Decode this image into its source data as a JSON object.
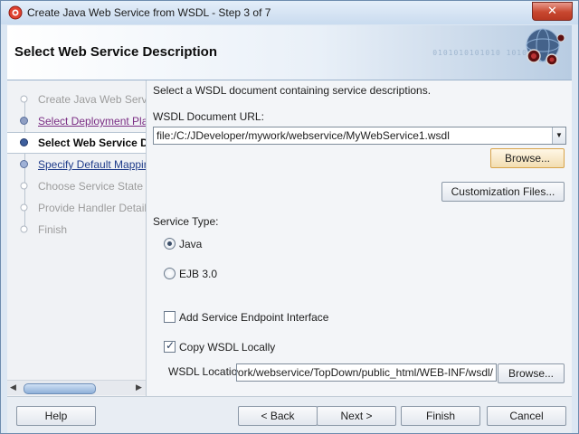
{
  "window": {
    "title": "Create Java Web Service from WSDL - Step 3 of 7",
    "close_symbol": "✕"
  },
  "header": {
    "title": "Select Web Service Description",
    "art_text": "0101010101010 101010101"
  },
  "nav": {
    "items": [
      {
        "label": "Create Java Web Servic",
        "state": "disabled"
      },
      {
        "label": "Select Deployment Platf",
        "state": "visited"
      },
      {
        "label": "Select Web Service D",
        "state": "current"
      },
      {
        "label": "Specify Default Mapping",
        "state": "link"
      },
      {
        "label": "Choose Service State",
        "state": "disabled"
      },
      {
        "label": "Provide Handler Details",
        "state": "disabled"
      },
      {
        "label": "Finish",
        "state": "disabled"
      }
    ],
    "scroll_left": "◀",
    "scroll_right": "▶"
  },
  "main": {
    "instruction": "Select a WSDL document containing service descriptions.",
    "wsdl_url_label": "WSDL Document URL:",
    "wsdl_url_value": "file:/C:/JDeveloper/mywork/webservice/MyWebService1.wsdl",
    "browse_label": "Browse...",
    "customization_label": "Customization Files...",
    "service_type_label": "Service Type:",
    "radio_java_label": "Java",
    "radio_ejb_label": "EJB 3.0",
    "radio_selected": "Java",
    "add_sei_label": "Add Service Endpoint Interface",
    "add_sei_checked": false,
    "copy_wsdl_label": "Copy WSDL Locally",
    "copy_wsdl_checked": true,
    "wsdl_location_label": "WSDL Location:",
    "wsdl_location_value": "/mywork/webservice/TopDown/public_html/WEB-INF/wsdl/",
    "browse2_label": "Browse..."
  },
  "footer": {
    "help_label": "Help",
    "back_label": "< Back",
    "next_label": "Next >",
    "finish_label": "Finish",
    "cancel_label": "Cancel"
  }
}
